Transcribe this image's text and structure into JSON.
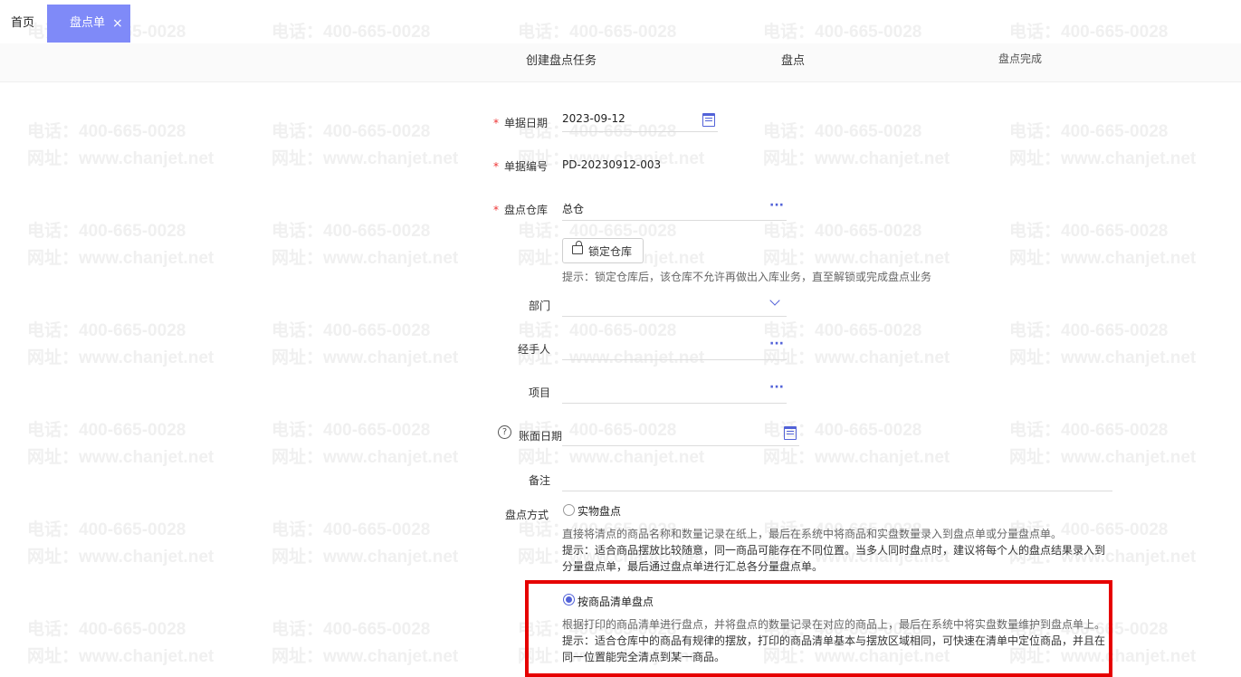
{
  "watermark": {
    "phone": "电话：400-665-0028",
    "site": "网址：www.chanjet.net"
  },
  "tabs": {
    "home": "首页",
    "active": "盘点单",
    "close": "×"
  },
  "steps": [
    "创建盘点任务",
    "盘点",
    "盘点完成"
  ],
  "form": {
    "doc_date": {
      "label": "单据日期",
      "value": "2023-09-12"
    },
    "doc_no": {
      "label": "单据编号",
      "value": "PD-20230912-003"
    },
    "warehouse": {
      "label": "盘点仓库",
      "value": "总仓"
    },
    "lock_button": "锁定仓库",
    "lock_hint": "提示：锁定仓库后，该仓库不允许再做出入库业务，直至解锁或完成盘点业务",
    "department": {
      "label": "部门",
      "value": ""
    },
    "handler": {
      "label": "经手人",
      "value": ""
    },
    "project": {
      "label": "项目",
      "value": ""
    },
    "book_date": {
      "label": "账面日期",
      "value": ""
    },
    "remark": {
      "label": "备注",
      "value": ""
    },
    "method": {
      "label": "盘点方式",
      "options": [
        {
          "label": "实物盘点",
          "selected": false,
          "desc": "直接将清点的商品名称和数量记录在纸上，最后在系统中将商品和实盘数量录入到盘点单或分量盘点单。",
          "tip1": "提示：适合商品摆放比较随意，同一商品可能存在不同位置。当多人同时盘点时，建议将每个人的盘点结果录入到",
          "tip2": "分量盘点单，最后通过盘点单进行汇总各分量盘点单。"
        },
        {
          "label": "按商品清单盘点",
          "selected": true,
          "desc": "根据打印的商品清单进行盘点，并将盘点的数量记录在对应的商品上，最后在系统中将实盘数量维护到盘点单上。",
          "tip1": "提示：适合仓库中的商品有规律的摆放，打印的商品清单基本与摆放区域相同，可快速在清单中定位商品，并且在",
          "tip2": "同一位置能完全清点到某一商品。"
        }
      ]
    }
  },
  "icons": {
    "calendar": "calendar-icon",
    "more": "more-icon",
    "chevron": "chevron-down-icon",
    "lock": "lock-icon",
    "help": "help-icon"
  },
  "colors": {
    "accent": "#5262d8",
    "tab_active": "#7f8af8",
    "required": "#e33333",
    "highlight": "#e60000"
  }
}
